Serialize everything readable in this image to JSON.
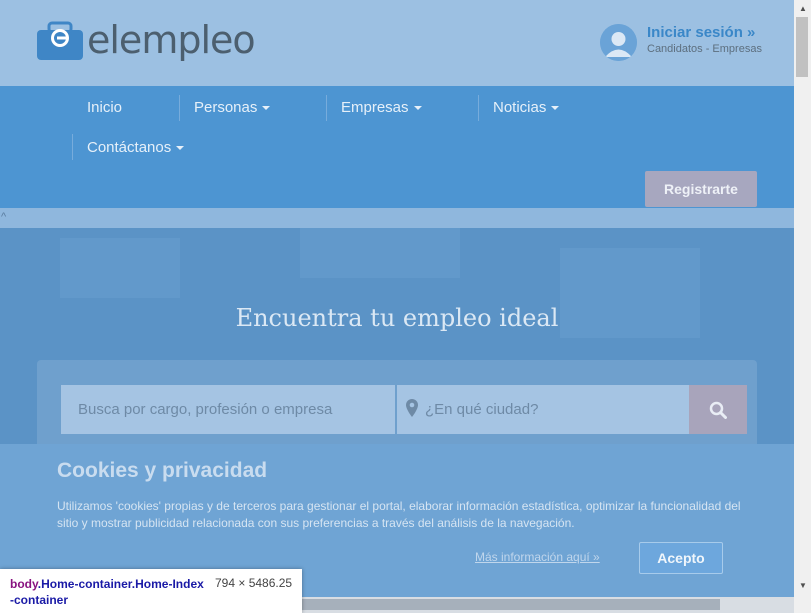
{
  "header": {
    "logo_text": "elempleo",
    "login_title": "Iniciar sesión »",
    "login_subtitle": "Candidatos - Empresas"
  },
  "nav": {
    "items": [
      {
        "label": "Inicio"
      },
      {
        "label": "Personas"
      },
      {
        "label": "Empresas"
      },
      {
        "label": "Noticias"
      },
      {
        "label": "Contáctanos"
      }
    ],
    "register_label": "Registrarte"
  },
  "hero": {
    "title": "Encuentra tu empleo ideal",
    "search_placeholder": "Busca por cargo, profesión o empresa",
    "city_placeholder": "¿En qué ciudad?"
  },
  "cookies": {
    "title": "Cookies y privacidad",
    "text": "Utilizamos 'cookies' propias y de terceros para gestionar el portal, elaborar información estadística, optimizar la funcionalidad del sitio y mostrar publicidad relacionada con sus preferencias a través del análisis de la navegación.",
    "more_label": "Más información aquí »",
    "accept_label": "Acepto"
  },
  "devtools_tooltip": {
    "element": "body",
    "classes": ".Home-container.Home-Index-container",
    "size": "794 × 5486.25"
  },
  "colors": {
    "nav_bg": "#4d95d2",
    "header_bg": "#9cc0e2",
    "login_accent": "#3a87c8"
  }
}
